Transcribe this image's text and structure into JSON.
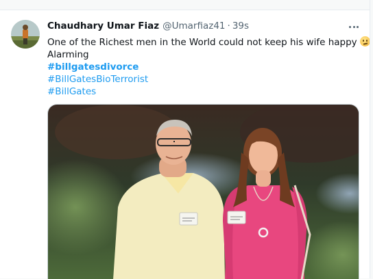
{
  "tweet": {
    "author_name": "Chaudhary Umar Fiaz",
    "handle": "@Umarfiaz41",
    "separator": "·",
    "time": "39s",
    "text_line1": "One of the Richest men in the World could not keep his wife happy",
    "text_line2": "Alarming",
    "emoji_icon": "face-with-raised-eyebrow-icon",
    "hashtags": [
      "#billgatesdivorce",
      "#BillGatesBioTerrorist",
      "#BillGates"
    ]
  },
  "colors": {
    "link": "#1d9bf0",
    "text": "#0f1419",
    "secondary": "#536471",
    "sweater_left": "#f3ecc0",
    "sweater_right": "#e8477f"
  },
  "media": {
    "alt": "",
    "badge_left_text": "",
    "badge_right_text": ""
  }
}
